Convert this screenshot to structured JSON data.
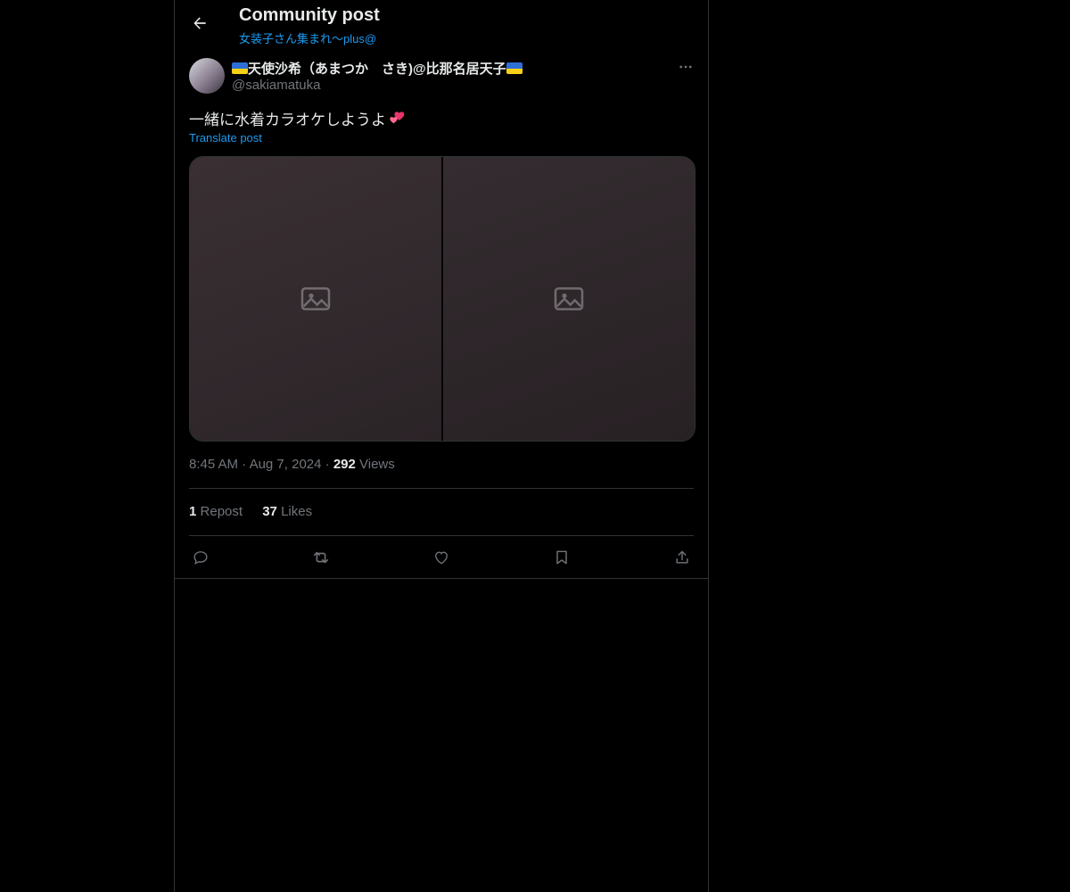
{
  "header": {
    "title": "Community post",
    "community_name": "女装子さん集まれ〜plus@"
  },
  "author": {
    "display_name": "天使沙希（あまつか　さき)@比那名居天子",
    "handle": "@sakiamatuka"
  },
  "post": {
    "text": "一緒に水着カラオケしようよ",
    "translate_label": "Translate post",
    "photos": [
      {
        "alt": "Photo 1"
      },
      {
        "alt": "Photo 2"
      }
    ],
    "time": "8:45 AM",
    "date": "Aug 7, 2024",
    "views_count": "292",
    "views_label": "Views",
    "separator": "·"
  },
  "stats": {
    "reposts_count": "1",
    "reposts_label": "Repost",
    "likes_count": "37",
    "likes_label": "Likes"
  },
  "icons": {
    "back": "arrow-left-icon",
    "more": "more-horizontal-icon",
    "reply": "reply-icon",
    "repost": "repost-icon",
    "like": "heart-icon",
    "bookmark": "bookmark-icon",
    "share": "share-icon"
  },
  "colors": {
    "background": "#000000",
    "text": "#e7e9ea",
    "muted": "#71767b",
    "accent": "#1d9bf0",
    "border": "#2f3336"
  }
}
